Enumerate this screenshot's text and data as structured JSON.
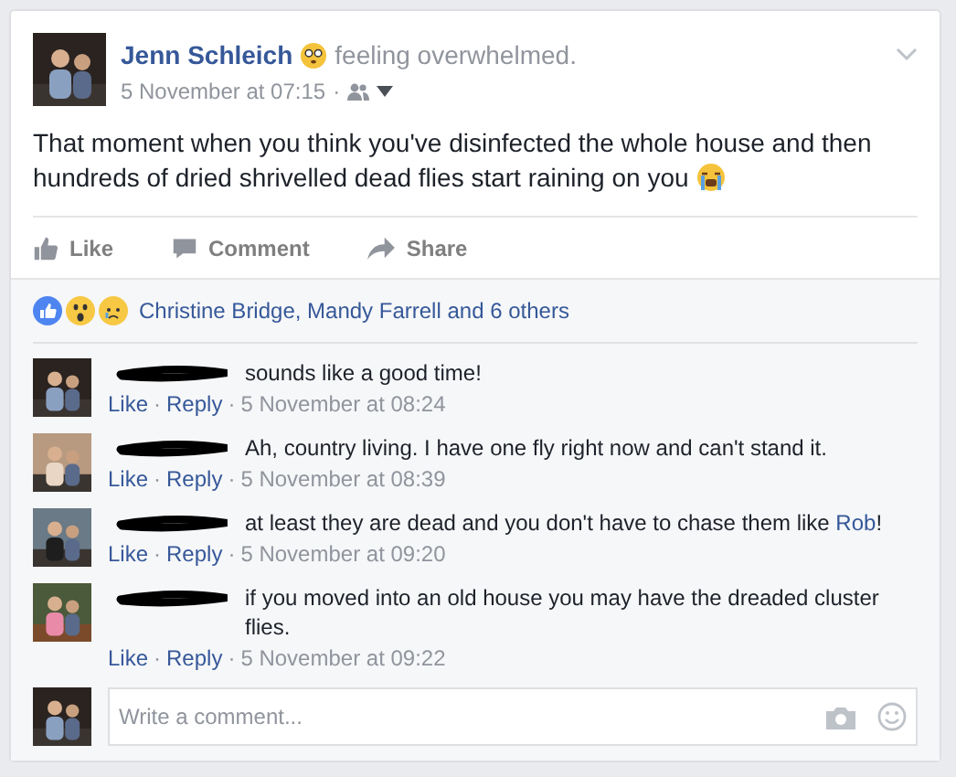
{
  "post": {
    "author": "Jenn Schleich",
    "feeling": "feeling overwhelmed.",
    "time": "5 November at 07:15",
    "separator": "·",
    "body": "That moment when you think you've disinfected the whole house and then hundreds of dried shrivelled dead flies start raining on you"
  },
  "actions": [
    "Like",
    "Comment",
    "Share"
  ],
  "reactions": {
    "summary": "Christine Bridge, Mandy Farrell and 6 others"
  },
  "comments": [
    {
      "segments": [
        {
          "kind": "plain",
          "text": "sounds like a good time!"
        }
      ],
      "like": "Like",
      "reply": "Reply",
      "time": "5 November at 08:24",
      "redacted": true
    },
    {
      "segments": [
        {
          "kind": "plain",
          "text": "Ah, country living. I have one fly right now and can't stand it."
        }
      ],
      "like": "Like",
      "reply": "Reply",
      "time": "5 November at 08:39",
      "redacted": true
    },
    {
      "segments": [
        {
          "kind": "plain",
          "text": "at least they are dead and you don't have to chase them like "
        },
        {
          "kind": "mention",
          "text": "Rob"
        },
        {
          "kind": "plain",
          "text": "!"
        }
      ],
      "like": "Like",
      "reply": "Reply",
      "time": "5 November at 09:20",
      "redacted": true
    },
    {
      "segments": [
        {
          "kind": "plain",
          "text": "if you moved into an old house you may have the dreaded cluster flies."
        }
      ],
      "like": "Like",
      "reply": "Reply",
      "time": "5 November at 09:22",
      "redacted": true
    }
  ],
  "composer": {
    "placeholder": "Write a comment..."
  }
}
